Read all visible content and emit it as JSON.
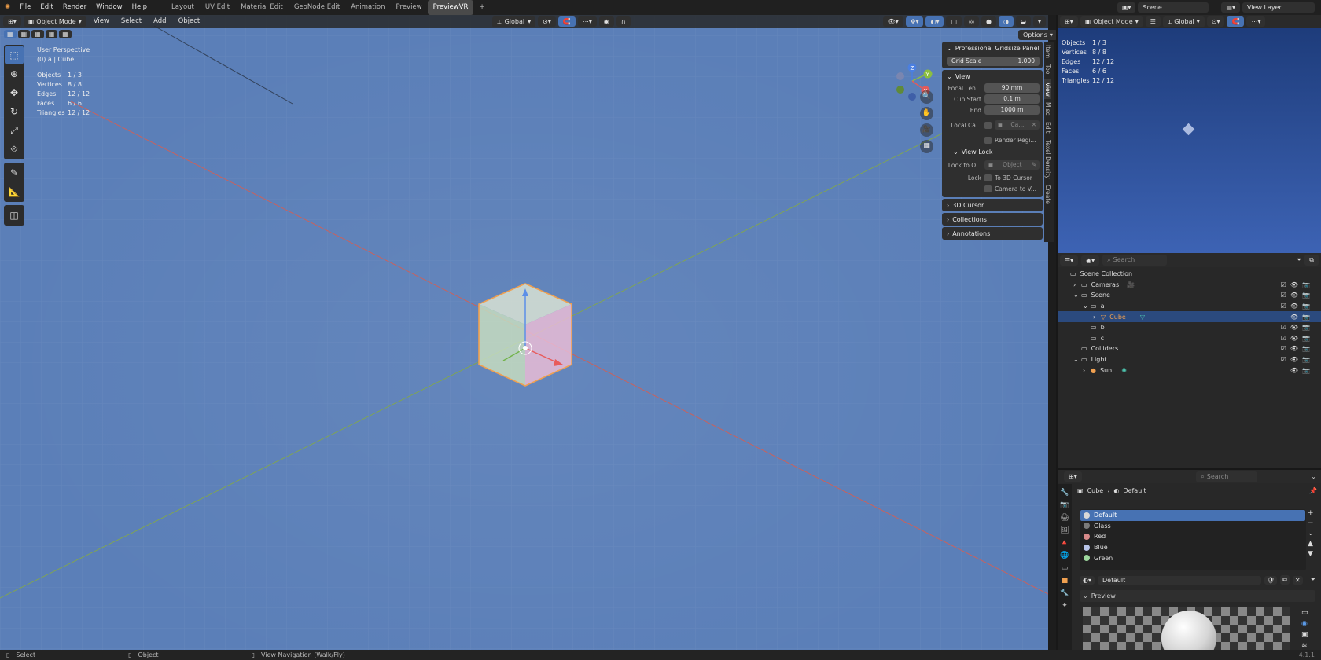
{
  "topbar": {
    "menus": [
      "File",
      "Edit",
      "Render",
      "Window",
      "Help"
    ],
    "workspaces": [
      "Layout",
      "UV Edit",
      "Material Edit",
      "GeoNode Edit",
      "Animation",
      "Preview",
      "PreviewVR"
    ],
    "active_workspace": "PreviewVR",
    "scene": "Scene",
    "view_layer": "View Layer"
  },
  "viewport_header": {
    "mode": "Object Mode",
    "menus": [
      "View",
      "Select",
      "Add",
      "Object"
    ],
    "orientation": "Global",
    "options": "Options"
  },
  "viewport_info": {
    "perspective": "User Perspective",
    "context": "(0) a | Cube",
    "stats": [
      {
        "label": "Objects",
        "value": "1 / 3"
      },
      {
        "label": "Vertices",
        "value": "8 / 8"
      },
      {
        "label": "Edges",
        "value": "12 / 12"
      },
      {
        "label": "Faces",
        "value": "6 / 6"
      },
      {
        "label": "Triangles",
        "value": "12 / 12"
      }
    ]
  },
  "gizmo": {
    "z": "Z",
    "y": "Y",
    "x": "X"
  },
  "npanel": {
    "gridsize_title": "Professional Gridsize Panel",
    "grid_scale_label": "Grid Scale",
    "grid_scale_value": "1.000",
    "view_title": "View",
    "focal_label": "Focal Len...",
    "focal_value": "90 mm",
    "clip_start_label": "Clip Start",
    "clip_start_value": "0.1 m",
    "end_label": "End",
    "end_value": "1000 m",
    "local_camera_label": "Local Ca...",
    "local_camera_value": "Ca...",
    "render_region_label": "Render Regi...",
    "view_lock_title": "View Lock",
    "lock_to_object_label": "Lock to O...",
    "lock_to_object_value": "Object",
    "lock_label": "Lock",
    "to_cursor_label": "To 3D Cursor",
    "camera_to_view_label": "Camera to V...",
    "cursor_title": "3D Cursor",
    "collections_title": "Collections",
    "annotations_title": "Annotations",
    "tabs": [
      "Item",
      "Tool",
      "View",
      "Misc",
      "Edit",
      "Texel Density",
      "Create"
    ]
  },
  "preview_stats": [
    {
      "label": "Objects",
      "value": "1 / 3"
    },
    {
      "label": "Vertices",
      "value": "8 / 8"
    },
    {
      "label": "Edges",
      "value": "12 / 12"
    },
    {
      "label": "Faces",
      "value": "6 / 6"
    },
    {
      "label": "Triangles",
      "value": "12 / 12"
    }
  ],
  "preview_header": {
    "mode": "Object Mode",
    "orientation": "Global"
  },
  "outliner": {
    "search_placeholder": "Search",
    "rows": [
      {
        "name": "Scene Collection",
        "indent": 0
      },
      {
        "name": "Cameras",
        "indent": 1
      },
      {
        "name": "Scene",
        "indent": 1
      },
      {
        "name": "a",
        "indent": 2
      },
      {
        "name": "Cube",
        "indent": 3
      },
      {
        "name": "b",
        "indent": 2
      },
      {
        "name": "c",
        "indent": 2
      },
      {
        "name": "Colliders",
        "indent": 1
      },
      {
        "name": "Light",
        "indent": 1
      },
      {
        "name": "Sun",
        "indent": 2
      }
    ]
  },
  "properties": {
    "search_placeholder": "Search",
    "breadcrumb_object": "Cube",
    "breadcrumb_material": "Default",
    "materials": [
      {
        "name": "Default",
        "color": "#d8d8d8"
      },
      {
        "name": "Glass",
        "color": "#7a7a7a"
      },
      {
        "name": "Red",
        "color": "#d88a8a"
      },
      {
        "name": "Blue",
        "color": "#b8c4e8"
      },
      {
        "name": "Green",
        "color": "#9ed89e"
      }
    ],
    "material_field": "Default",
    "preview_title": "Preview"
  },
  "statusbar": {
    "select": "Select",
    "object": "Object",
    "navigation": "View Navigation (Walk/Fly)",
    "version": "4.1.1"
  },
  "colors": {
    "accent": "#4772b3",
    "viewport": "#5b7fb8",
    "selection_outline": "#f0a050"
  }
}
